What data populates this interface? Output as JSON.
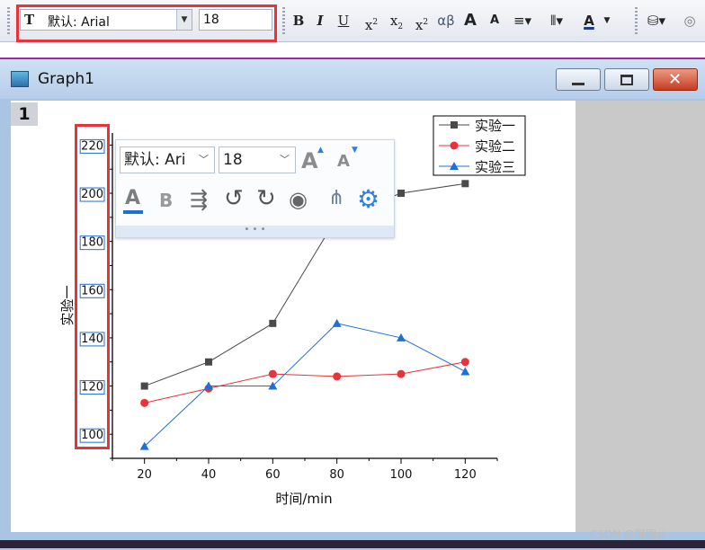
{
  "toolbar": {
    "font_value": "默认: Arial",
    "size_value": "18",
    "tt_glyph": "T",
    "bold": "B",
    "italic": "I",
    "underline": "U",
    "sup": "x",
    "sup_mark": "2",
    "sub": "x",
    "sub_mark": "2",
    "supsub": "x",
    "supsub_mark": "2",
    "greek": "αβ",
    "grow": "A",
    "shrink": "A",
    "font_color": "A"
  },
  "window": {
    "title": "Graph1",
    "layer_label": "1"
  },
  "mini_toolbar": {
    "font_value": "默认: Ari",
    "size_value": "18",
    "grow": "A",
    "shrink": "A",
    "font_color": "A",
    "bold": "B",
    "handle": "• • •"
  },
  "chart_data": {
    "type": "line",
    "xlabel": "时间/min",
    "ylabel": "实验一",
    "x": [
      20,
      40,
      60,
      80,
      100,
      120
    ],
    "xlim": [
      10,
      130
    ],
    "ylim": [
      90,
      225
    ],
    "x_ticks": [
      "20",
      "40",
      "60",
      "80",
      "100",
      "120"
    ],
    "y_ticks": [
      "100",
      "120",
      "140",
      "160",
      "180",
      "200",
      "220"
    ],
    "legend_position": "top-right",
    "series": [
      {
        "name": "实验一",
        "color": "#4a4a4a",
        "marker": "square",
        "values": [
          120,
          130,
          146,
          190,
          200,
          204
        ]
      },
      {
        "name": "实验二",
        "color": "#e8333a",
        "marker": "circle",
        "values": [
          113,
          119,
          125,
          124,
          125,
          130
        ]
      },
      {
        "name": "实验三",
        "color": "#1f6fd8",
        "marker": "triangle",
        "values": [
          95,
          120,
          120,
          146,
          140,
          126
        ]
      }
    ]
  },
  "watermark": "CSDN @圆圆zi",
  "colors": {
    "highlight_box": "#e8333a",
    "window_frame": "#aac4e3"
  }
}
